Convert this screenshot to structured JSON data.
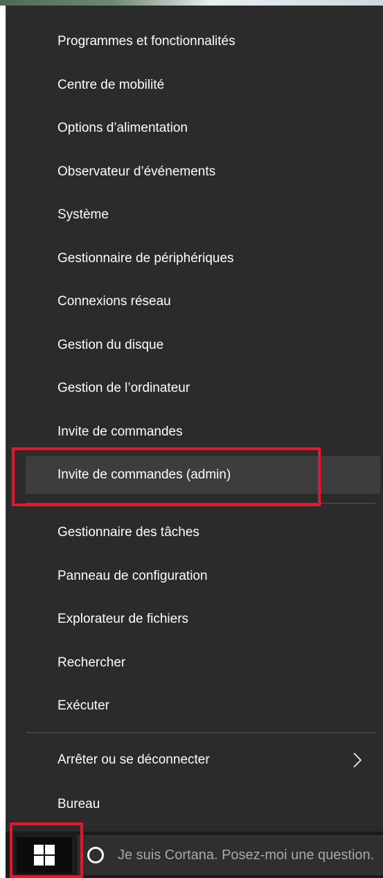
{
  "menu": {
    "items": [
      {
        "label": "Programmes et fonctionnalités"
      },
      {
        "label": "Centre de mobilité"
      },
      {
        "label": "Options d’alimentation"
      },
      {
        "label": "Observateur d’événements"
      },
      {
        "label": "Système"
      },
      {
        "label": "Gestionnaire de périphériques"
      },
      {
        "label": "Connexions réseau"
      },
      {
        "label": "Gestion du disque"
      },
      {
        "label": "Gestion de l’ordinateur"
      },
      {
        "label": "Invite de commandes"
      },
      {
        "label": "Invite de commandes (admin)",
        "highlighted": true
      },
      {
        "label": "Gestionnaire des tâches"
      },
      {
        "label": "Panneau de configuration"
      },
      {
        "label": "Explorateur de fichiers"
      },
      {
        "label": "Rechercher"
      },
      {
        "label": "Exécuter"
      },
      {
        "label": "Arrêter ou se déconnecter",
        "submenu_icon": "chevron-right-icon"
      },
      {
        "label": "Bureau"
      }
    ]
  },
  "taskbar": {
    "start_icon": "windows-logo-icon",
    "cortana_icon": "cortana-ring-icon",
    "search_placeholder": "Je suis Cortana. Posez-moi une question."
  },
  "colors": {
    "menu_background": "#2b2b2b",
    "menu_highlight": "#3d3d3d",
    "menu_text": "#ffffff",
    "annotation": "#e5172c",
    "taskbar": "#1c1c1c"
  }
}
